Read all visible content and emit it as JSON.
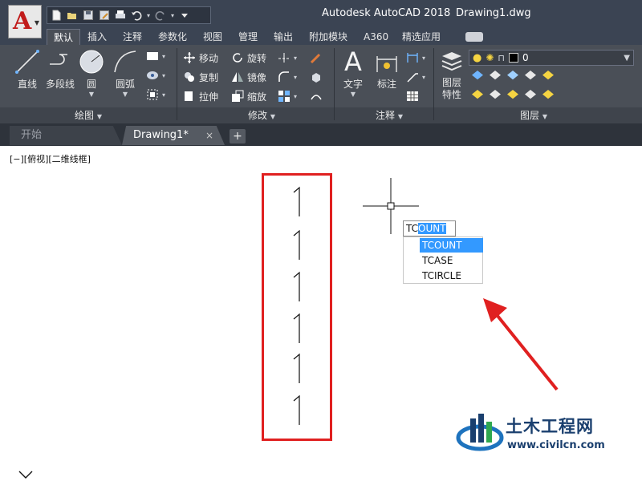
{
  "title": {
    "app_name": "Autodesk AutoCAD 2018",
    "document_name": "Drawing1.dwg"
  },
  "app_button": {
    "icon": "autocad-logo-icon",
    "letter": "A"
  },
  "quick_access": [
    "new-file-icon",
    "open-icon",
    "save-icon",
    "save-as-icon",
    "print-icon",
    "undo-icon",
    "redo-icon",
    "customize-icon"
  ],
  "ribbon_tabs": [
    "默认",
    "插入",
    "注释",
    "参数化",
    "视图",
    "管理",
    "输出",
    "附加模块",
    "A360",
    "精选应用"
  ],
  "active_tab": "默认",
  "panels": {
    "draw": {
      "title": "绘图",
      "tools": {
        "line": "直线",
        "polyline": "多段线",
        "circle": "圆",
        "arc": "圆弧"
      }
    },
    "modify": {
      "title": "修改",
      "tools": {
        "move": "移动",
        "rotate": "旋转",
        "copy": "复制",
        "mirror": "镜像",
        "stretch": "拉伸",
        "scale": "缩放"
      }
    },
    "annotation": {
      "title": "注释",
      "tools": {
        "text": "文字",
        "dimension": "标注"
      }
    },
    "layers": {
      "title": "图层",
      "properties_line1": "图层",
      "properties_line2": "特性",
      "current_layer": "0"
    }
  },
  "doc_tabs": {
    "start": "开始",
    "drawing": "Drawing1*",
    "close": "×",
    "add": "+"
  },
  "viewport": {
    "label": "[−][俯视][二维线框]"
  },
  "drawing_texts": [
    "1",
    "1",
    "1",
    "1",
    "1",
    "1"
  ],
  "command": {
    "typed": "TC",
    "autocomplete": "OUNT",
    "suggestions": [
      "TCOUNT",
      "TCASE",
      "TCIRCLE"
    ],
    "selected_suggestion": "TCOUNT"
  },
  "watermark": {
    "name": "土木工程网",
    "url": "www.civilcn.com"
  },
  "colors": {
    "title_bar": "#3b4453",
    "ribbon": "#4a4f57",
    "highlight": "#e02020",
    "selection": "#3399ff",
    "watermark": "#1a3f6e"
  }
}
